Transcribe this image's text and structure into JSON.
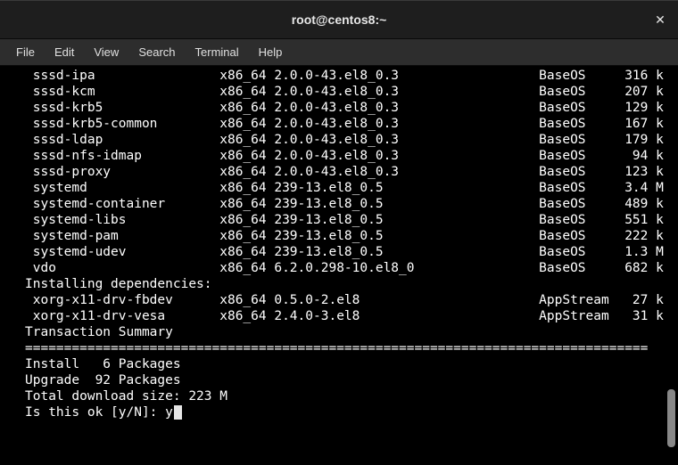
{
  "window": {
    "title": "root@centos8:~",
    "close_glyph": "✕"
  },
  "menu": {
    "items": [
      "File",
      "Edit",
      "View",
      "Search",
      "Terminal",
      "Help"
    ]
  },
  "columns": {
    "name_w": 24,
    "arch_w": 7,
    "ver_w": 34,
    "repo_w": 10,
    "size_w": 6
  },
  "packages": [
    {
      "name": "sssd-ipa",
      "arch": "x86_64",
      "ver": "2.0.0-43.el8_0.3",
      "repo": "BaseOS",
      "size": "316 k"
    },
    {
      "name": "sssd-kcm",
      "arch": "x86_64",
      "ver": "2.0.0-43.el8_0.3",
      "repo": "BaseOS",
      "size": "207 k"
    },
    {
      "name": "sssd-krb5",
      "arch": "x86_64",
      "ver": "2.0.0-43.el8_0.3",
      "repo": "BaseOS",
      "size": "129 k"
    },
    {
      "name": "sssd-krb5-common",
      "arch": "x86_64",
      "ver": "2.0.0-43.el8_0.3",
      "repo": "BaseOS",
      "size": "167 k"
    },
    {
      "name": "sssd-ldap",
      "arch": "x86_64",
      "ver": "2.0.0-43.el8_0.3",
      "repo": "BaseOS",
      "size": "179 k"
    },
    {
      "name": "sssd-nfs-idmap",
      "arch": "x86_64",
      "ver": "2.0.0-43.el8_0.3",
      "repo": "BaseOS",
      "size": " 94 k"
    },
    {
      "name": "sssd-proxy",
      "arch": "x86_64",
      "ver": "2.0.0-43.el8_0.3",
      "repo": "BaseOS",
      "size": "123 k"
    },
    {
      "name": "systemd",
      "arch": "x86_64",
      "ver": "239-13.el8_0.5",
      "repo": "BaseOS",
      "size": "3.4 M"
    },
    {
      "name": "systemd-container",
      "arch": "x86_64",
      "ver": "239-13.el8_0.5",
      "repo": "BaseOS",
      "size": "489 k"
    },
    {
      "name": "systemd-libs",
      "arch": "x86_64",
      "ver": "239-13.el8_0.5",
      "repo": "BaseOS",
      "size": "551 k"
    },
    {
      "name": "systemd-pam",
      "arch": "x86_64",
      "ver": "239-13.el8_0.5",
      "repo": "BaseOS",
      "size": "222 k"
    },
    {
      "name": "systemd-udev",
      "arch": "x86_64",
      "ver": "239-13.el8_0.5",
      "repo": "BaseOS",
      "size": "1.3 M"
    },
    {
      "name": "vdo",
      "arch": "x86_64",
      "ver": "6.2.0.298-10.el8_0",
      "repo": "BaseOS",
      "size": "682 k"
    }
  ],
  "deps_header": "Installing dependencies:",
  "deps": [
    {
      "name": "xorg-x11-drv-fbdev",
      "arch": "x86_64",
      "ver": "0.5.0-2.el8",
      "repo": "AppStream",
      "size": " 27 k"
    },
    {
      "name": "xorg-x11-drv-vesa",
      "arch": "x86_64",
      "ver": "2.4.0-3.el8",
      "repo": "AppStream",
      "size": " 31 k"
    }
  ],
  "summary": {
    "header": "Transaction Summary",
    "rule": "================================================================================",
    "install": "Install   6 Packages",
    "upgrade": "Upgrade  92 Packages",
    "total": "Total download size: 223 M",
    "prompt": "Is this ok [y/N]: ",
    "answer": "y"
  }
}
